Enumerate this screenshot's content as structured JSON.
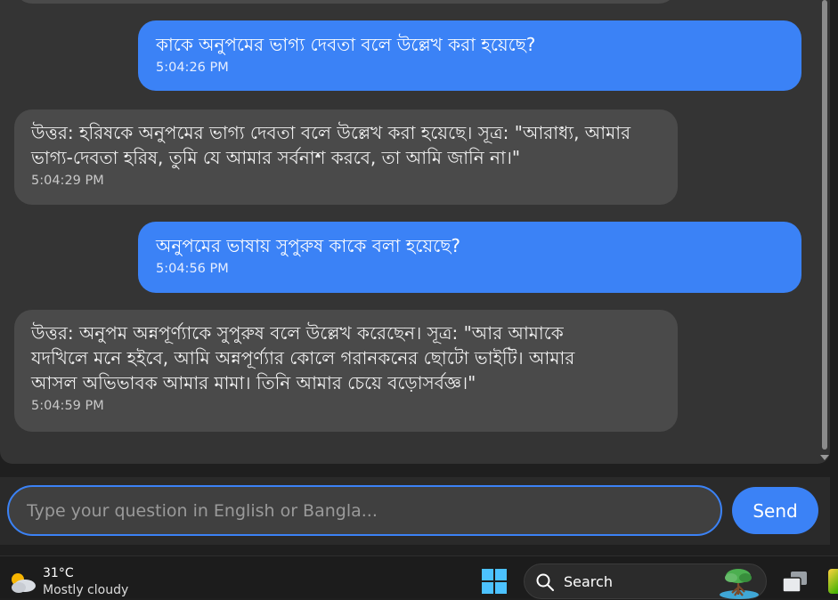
{
  "chat": {
    "messages": [
      {
        "role": "user",
        "text": "কাকে অনুপমের ভাগ্য দেবতা বলে উল্লেখ করা হয়েছে?",
        "time": "5:04:26 PM"
      },
      {
        "role": "bot",
        "text": "উত্তর: হরিষকে অনুপমের ভাগ্য দেবতা বলে উল্লেখ করা হয়েছে। সূত্র: \"আরাধ্য, আমার\nভাগ্য-দেবতা হরিষ, তুমি যে আমার সর্বনাশ করবে, তা আমি জানি না।\"",
        "time": "5:04:29 PM"
      },
      {
        "role": "user",
        "text": "অনুপমের ভাষায় সুপুরুষ কাকে বলা হয়েছে?",
        "time": "5:04:56 PM"
      },
      {
        "role": "bot",
        "text": "উত্তর: অনুপম অন্নপূর্ণ্যাকে সুপুরুষ বলে উল্লেখ করেছেন। সূত্র: \"আর আমাকে\nযদখিলে মনে হইবে, আমি অন্নপূর্ণ্যার কোলে গরানকনের ছোটো ভাইটি। আমার\nআসল অভিভাবক আমার মামা। তিনি আমার চেয়ে বড়োসর্বজ্ঞ।\"",
        "time": "5:04:59 PM"
      }
    ]
  },
  "input": {
    "placeholder": "Type your question in English or Bangla...",
    "value": ""
  },
  "send_label": "Send",
  "taskbar": {
    "weather_temp": "31°C",
    "weather_desc": "Mostly cloudy",
    "search_label": "Search"
  },
  "icons": {
    "weather": "partly-cloudy-icon",
    "start": "windows-logo-icon",
    "search": "magnifier-icon",
    "task_view": "task-view-icon"
  },
  "colors": {
    "accent": "#3b82f6",
    "bot_bubble": "#4a4a4a",
    "chat_background": "#343434",
    "taskbar": "#1c1c1c"
  }
}
